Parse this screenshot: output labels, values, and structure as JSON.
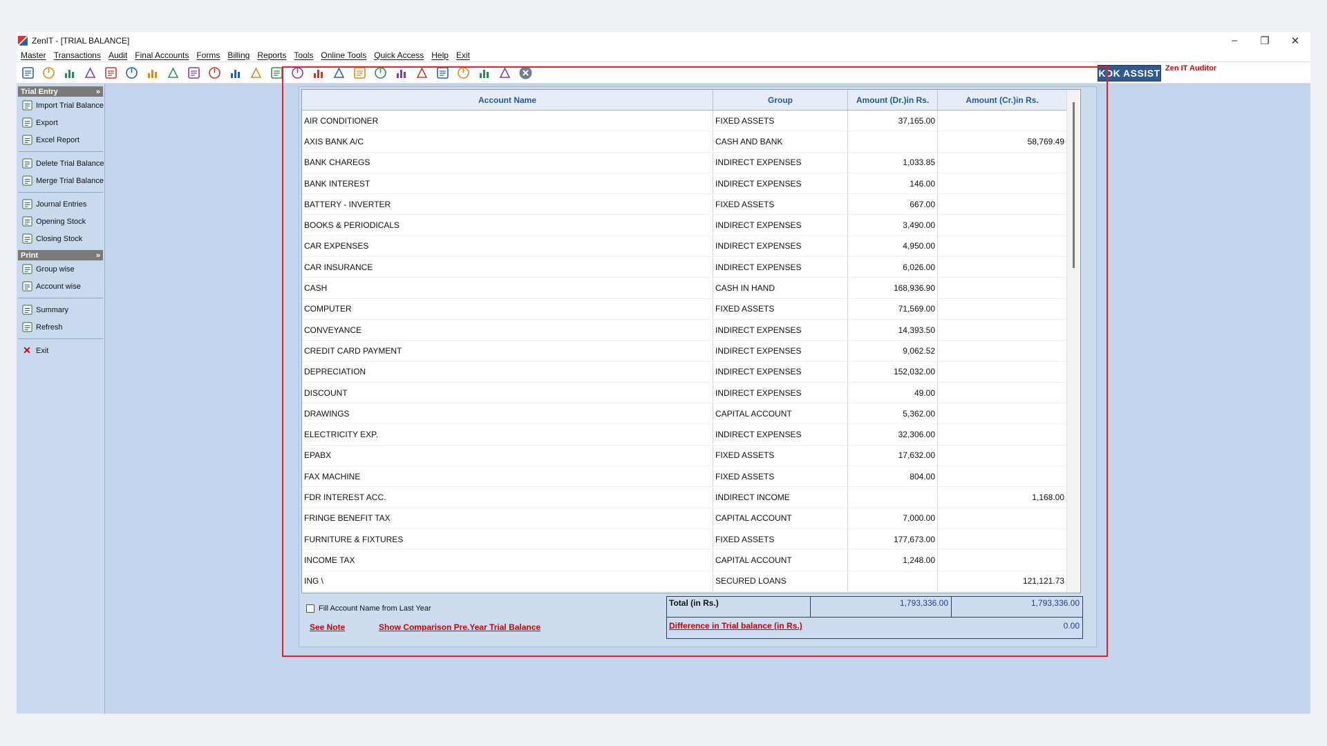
{
  "window": {
    "title": "ZenIT - [TRIAL BALANCE]",
    "controls": [
      "–",
      "❐",
      "✕"
    ]
  },
  "menu": [
    "Master",
    "Transactions",
    "Audit",
    "Final Accounts",
    "Forms",
    "Billing",
    "Reports",
    "Tools",
    "Online Tools",
    "Quick Access",
    "Help",
    "Exit"
  ],
  "toolbar": {
    "icons": [
      "open-icon",
      "home-icon",
      "building-icon",
      "bar-chart-icon",
      "gift-icon",
      "users-icon",
      "tag-icon",
      "filter-icon",
      "tax-icon",
      "eye-icon",
      "calculator-icon",
      "pie-icon",
      "pay-icon",
      "book-icon",
      "info-icon",
      "report-icon",
      "document-icon",
      "calendar-icon",
      "globe-icon",
      "refresh-doc-icon",
      "bs-icon",
      "printer-icon",
      "3cd-icon",
      "ledger-icon",
      "close-circle-icon"
    ],
    "kdk_label": "KDK ASSIST",
    "auditor_label": "Zen IT Auditor"
  },
  "sidebar": {
    "trial_entry_header": "Trial Entry",
    "trial_items": [
      "Import Trial Balance",
      "Export",
      "Excel Report"
    ],
    "manage_items": [
      "Delete Trial Balance",
      "Merge Trial Balance"
    ],
    "entry_items": [
      "Journal Entries",
      "Opening Stock",
      "Closing Stock"
    ],
    "print_header": "Print",
    "print_items": [
      "Group wise",
      "Account wise"
    ],
    "other_items": [
      "Summary",
      "Refresh"
    ],
    "exit_label": "Exit"
  },
  "grid": {
    "headers": [
      "Account Name",
      "Group",
      "Amount (Dr.)in Rs.",
      "Amount (Cr.)in Rs."
    ],
    "rows": [
      [
        "AIR CONDITIONER",
        "FIXED ASSETS",
        "37,165.00",
        ""
      ],
      [
        "AXIS BANK A/C",
        "CASH AND BANK",
        "",
        "58,769.49"
      ],
      [
        "BANK CHAREGS",
        "INDIRECT EXPENSES",
        "1,033.85",
        ""
      ],
      [
        "BANK INTEREST",
        "INDIRECT EXPENSES",
        "146.00",
        ""
      ],
      [
        "BATTERY - INVERTER",
        "FIXED ASSETS",
        "667.00",
        ""
      ],
      [
        "BOOKS & PERIODICALS",
        "INDIRECT EXPENSES",
        "3,490.00",
        ""
      ],
      [
        "CAR EXPENSES",
        "INDIRECT EXPENSES",
        "4,950.00",
        ""
      ],
      [
        "CAR INSURANCE",
        "INDIRECT EXPENSES",
        "6,026.00",
        ""
      ],
      [
        "CASH",
        "CASH IN HAND",
        "168,936.90",
        ""
      ],
      [
        "COMPUTER",
        "FIXED ASSETS",
        "71,569.00",
        ""
      ],
      [
        "CONVEYANCE",
        "INDIRECT EXPENSES",
        "14,393.50",
        ""
      ],
      [
        "CREDIT CARD PAYMENT",
        "INDIRECT EXPENSES",
        "9,062.52",
        ""
      ],
      [
        "DEPRECIATION",
        "INDIRECT EXPENSES",
        "152,032.00",
        ""
      ],
      [
        "DISCOUNT",
        "INDIRECT EXPENSES",
        "49.00",
        ""
      ],
      [
        "DRAWINGS",
        "CAPITAL ACCOUNT",
        "5,362.00",
        ""
      ],
      [
        "ELECTRICITY EXP.",
        "INDIRECT EXPENSES",
        "32,306.00",
        ""
      ],
      [
        "EPABX",
        "FIXED ASSETS",
        "17,632.00",
        ""
      ],
      [
        "FAX MACHINE",
        "FIXED ASSETS",
        "804.00",
        ""
      ],
      [
        "FDR INTEREST ACC.",
        "INDIRECT INCOME",
        "",
        "1,168.00"
      ],
      [
        "FRINGE BENEFIT TAX",
        "CAPITAL ACCOUNT",
        "7,000.00",
        ""
      ],
      [
        "FURNITURE & FIXTURES",
        "FIXED ASSETS",
        "177,673.00",
        ""
      ],
      [
        "INCOME TAX",
        "CAPITAL ACCOUNT",
        "1,248.00",
        ""
      ],
      [
        "ING \\",
        "SECURED LOANS",
        "",
        "121,121.73"
      ]
    ]
  },
  "footer": {
    "fill_checkbox_label": "Fill Account Name from Last Year",
    "see_note": "See Note",
    "show_comparison": "Show Comparison Pre.Year Trial Balance",
    "total_label": "Total (in Rs.)",
    "total_dr": "1,793,336.00",
    "total_cr": "1,793,336.00",
    "difference_label": "Difference in Trial balance (in Rs.)",
    "difference_value": "0.00"
  }
}
